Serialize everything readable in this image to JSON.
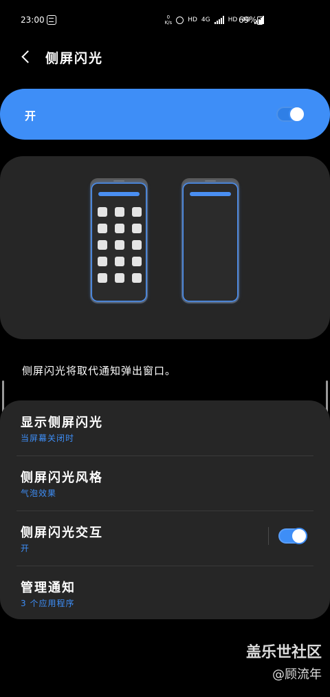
{
  "status_bar": {
    "time": "23:00",
    "net_speed_top": "0",
    "net_speed_bottom": "K/s",
    "hd1": "HD",
    "net1": "4G",
    "hd2": "HD",
    "net2": "4G",
    "battery": "69%"
  },
  "header": {
    "title": "侧屏闪光"
  },
  "master_switch": {
    "label": "开",
    "on": true
  },
  "description": "侧屏闪光将取代通知弹出窗口。",
  "settings": {
    "items": [
      {
        "title": "显示侧屏闪光",
        "subtitle": "当屏幕关闭时"
      },
      {
        "title": "侧屏闪光风格",
        "subtitle": "气泡效果"
      },
      {
        "title": "侧屏闪光交互",
        "subtitle": "开",
        "toggle_on": true
      },
      {
        "title": "管理通知",
        "subtitle": "3 个应用程序"
      }
    ]
  },
  "watermark": {
    "title": "盖乐世社区",
    "author": "@顾流年"
  },
  "colors": {
    "accent": "#3e8ef7",
    "card": "#262626",
    "background": "#000000"
  }
}
